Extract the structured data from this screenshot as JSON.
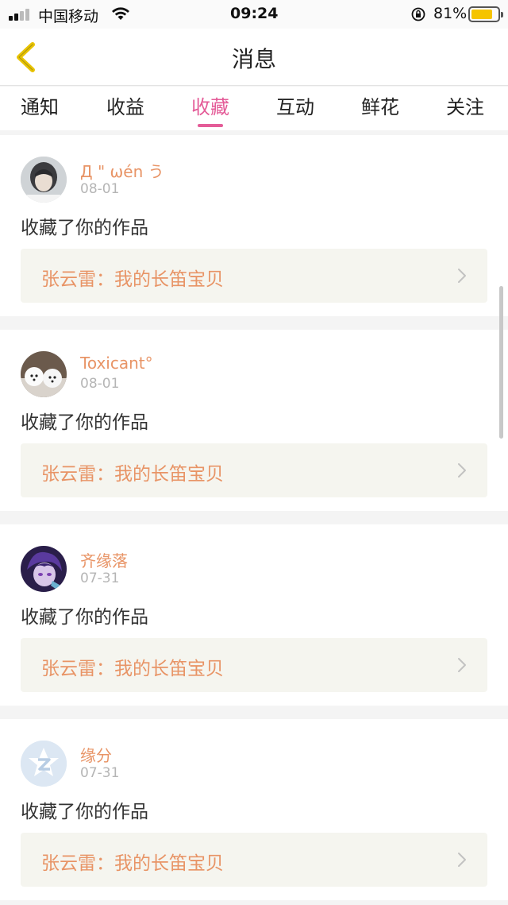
{
  "status": {
    "carrier": "中国移动",
    "time": "09:24",
    "battery": "81%",
    "battery_level": 0.81,
    "battery_color": "#f5c400"
  },
  "nav": {
    "title": "消息",
    "back_icon": "chevron-left-icon",
    "back_color": "#e8c300"
  },
  "tabs": [
    {
      "label": "通知",
      "active": false
    },
    {
      "label": "收益",
      "active": false
    },
    {
      "label": "收藏",
      "active": true
    },
    {
      "label": "互动",
      "active": false
    },
    {
      "label": "鲜花",
      "active": false
    },
    {
      "label": "关注",
      "active": false
    }
  ],
  "accent_color": "#e45c98",
  "name_color": "#e89466",
  "messages": [
    {
      "name": "Д \" ωén う",
      "date": "08-01",
      "action": "收藏了你的作品",
      "work": "张云雷：我的长笛宝贝",
      "avatar": "photo-avatar"
    },
    {
      "name": "Toxicant°",
      "date": "08-01",
      "action": "收藏了你的作品",
      "work": "张云雷：我的长笛宝贝",
      "avatar": "dogs-avatar"
    },
    {
      "name": "齐缘落",
      "date": "07-31",
      "action": "收藏了你的作品",
      "work": "张云雷：我的长笛宝贝",
      "avatar": "anime-avatar"
    },
    {
      "name": "缘分",
      "date": "07-31",
      "action": "收藏了你的作品",
      "work": "张云雷：我的长笛宝贝",
      "avatar": "qq-default-avatar"
    }
  ]
}
